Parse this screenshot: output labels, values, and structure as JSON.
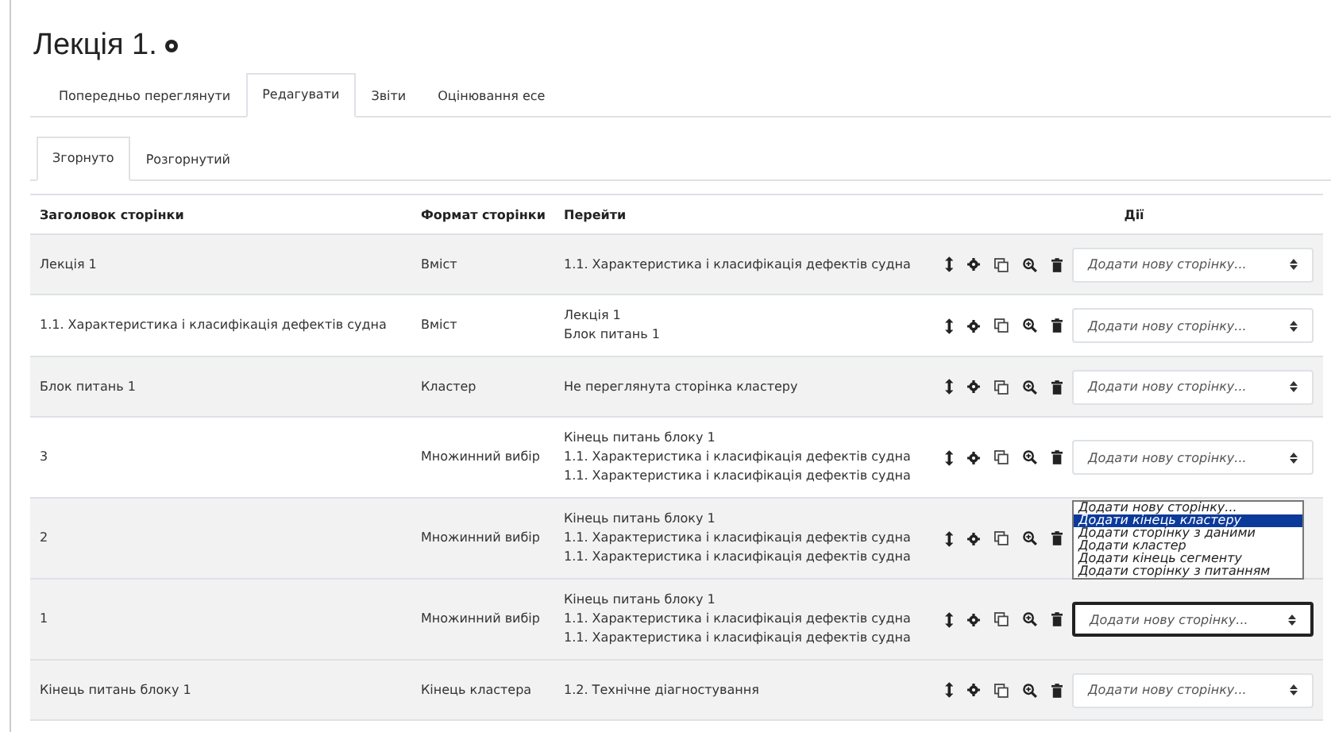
{
  "page": {
    "title": "Лекція 1."
  },
  "tabs": [
    {
      "label": "Попередньо переглянути",
      "selected": false
    },
    {
      "label": "Редагувати",
      "selected": true
    },
    {
      "label": "Звіти",
      "selected": false
    },
    {
      "label": "Оцінювання есе",
      "selected": false
    }
  ],
  "subtabs": [
    {
      "label": "Згорнуто",
      "selected": true
    },
    {
      "label": "Розгорнутий",
      "selected": false
    }
  ],
  "table": {
    "columns": [
      "Заголовок сторінки",
      "Формат сторінки",
      "Перейти",
      "Дії"
    ],
    "rows": [
      {
        "title": "Лекція 1",
        "format": "Вміст",
        "jumps": [
          "1.1. Характеристика і класифікація дефектів судна"
        ],
        "select": {
          "value": "Додати нову сторінку...",
          "focused": false
        }
      },
      {
        "title": "1.1. Характеристика і класифікація дефектів судна",
        "format": "Вміст",
        "jumps": [
          "Лекція 1",
          "Блок питань 1"
        ],
        "select": {
          "value": "Додати нову сторінку...",
          "focused": false
        }
      },
      {
        "title": "Блок питань 1",
        "format": "Кластер",
        "jumps": [
          "Не переглянута сторінка кластеру"
        ],
        "select": {
          "value": "Додати нову сторінку...",
          "focused": false
        }
      },
      {
        "title": "3",
        "format": "Множинний вибір",
        "jumps": [
          "Кінець питань блоку 1",
          "1.1. Характеристика і класифікація дефектів судна",
          "1.1. Характеристика і класифікація дефектів судна"
        ],
        "select": {
          "value": "Додати нову сторінку...",
          "focused": false
        }
      },
      {
        "title": "2",
        "format": "Множинний вибір",
        "jumps": [
          "Кінець питань блоку 1",
          "1.1. Характеристика і класифікація дефектів судна",
          "1.1. Характеристика і класифікація дефектів судна"
        ],
        "open_list": [
          {
            "label": "Додати нову сторінку...",
            "selected": false
          },
          {
            "label": "Додати кінець кластеру",
            "selected": true
          },
          {
            "label": "Додати сторінку з даними",
            "selected": false
          },
          {
            "label": "Додати кластер",
            "selected": false
          },
          {
            "label": "Додати кінець сегменту",
            "selected": false
          },
          {
            "label": "Додати сторінку з питанням",
            "selected": false
          }
        ]
      },
      {
        "title": "1",
        "format": "Множинний вибір",
        "jumps": [
          "Кінець питань блоку 1",
          "1.1. Характеристика і класифікація дефектів судна",
          "1.1. Характеристика і класифікація дефектів судна"
        ],
        "select": {
          "value": "Додати нову сторінку...",
          "focused": true
        }
      },
      {
        "title": "Кінець питань блоку 1",
        "format": "Кінець кластера",
        "jumps": [
          "1.2. Технічне діагностування"
        ],
        "select": {
          "value": "Додати нову сторінку...",
          "focused": false
        }
      }
    ]
  }
}
